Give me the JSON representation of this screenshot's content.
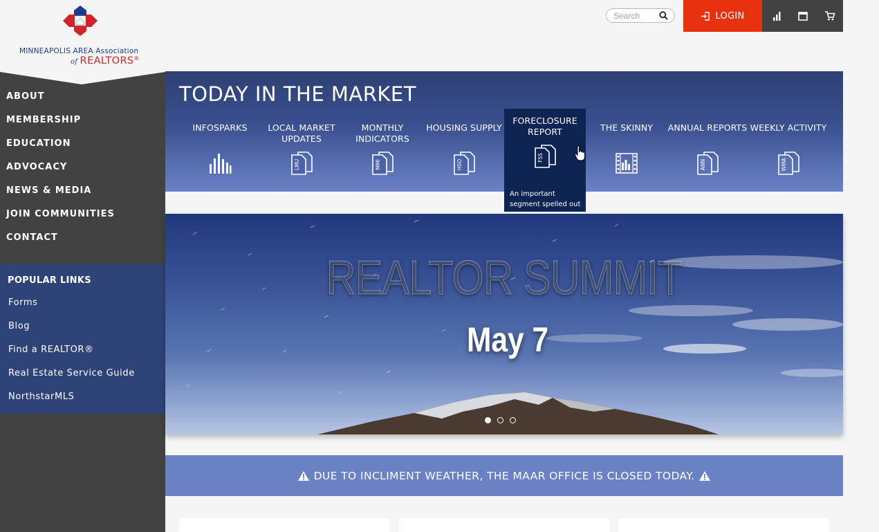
{
  "brand": {
    "line1": "MINNEAPOLIS AREA Association",
    "of": "of",
    "line2": "REALTORS",
    "reg": "®"
  },
  "topbar": {
    "search_placeholder": "Search",
    "login_label": "LOGIN",
    "icons": [
      "bar-chart-icon",
      "calendar-icon",
      "cart-icon"
    ]
  },
  "sidebar": {
    "nav": [
      "ABOUT",
      "MEMBERSHIP",
      "EDUCATION",
      "ADVOCACY",
      "NEWS & MEDIA",
      "JOIN COMMUNITIES",
      "CONTACT"
    ],
    "popular_title": "POPULAR LINKS",
    "popular": [
      "Forms",
      "Blog",
      "Find a REALTOR®",
      "Real Estate Service Guide",
      "NorthstarMLS"
    ]
  },
  "market": {
    "title": "TODAY IN THE MARKET",
    "items": [
      {
        "label": "INFOSPARKS",
        "icon": "bars"
      },
      {
        "label": "LOCAL MARKET UPDATES",
        "icon": "LMU"
      },
      {
        "label": "MONTHLY INDICATORS",
        "icon": "MMI"
      },
      {
        "label": "HOUSING SUPPLY",
        "icon": "HSO"
      },
      {
        "label": "FORECLOSURE REPORT",
        "icon": "FSS",
        "tooltip": "An important segment spelled out"
      },
      {
        "label": "THE SKINNY",
        "icon": "film"
      },
      {
        "label": "ANNUAL REPORTS",
        "icon": "ANN"
      },
      {
        "label": "WEEKLY ACTIVITY",
        "icon": "WMA"
      }
    ],
    "active_index": 4
  },
  "hero": {
    "title": "REALTOR SUMMIT",
    "date": "May 7",
    "slides": 3,
    "active_slide": 0
  },
  "alert": {
    "text": "DUE TO INCLIMENT WEATHER, THE MAAR OFFICE IS CLOSED TODAY."
  },
  "colors": {
    "login": "#e8320f",
    "sidebar": "#424242",
    "popular": "#2e4377",
    "active_tile": "#0e2452",
    "alert": "#6a81c3"
  }
}
